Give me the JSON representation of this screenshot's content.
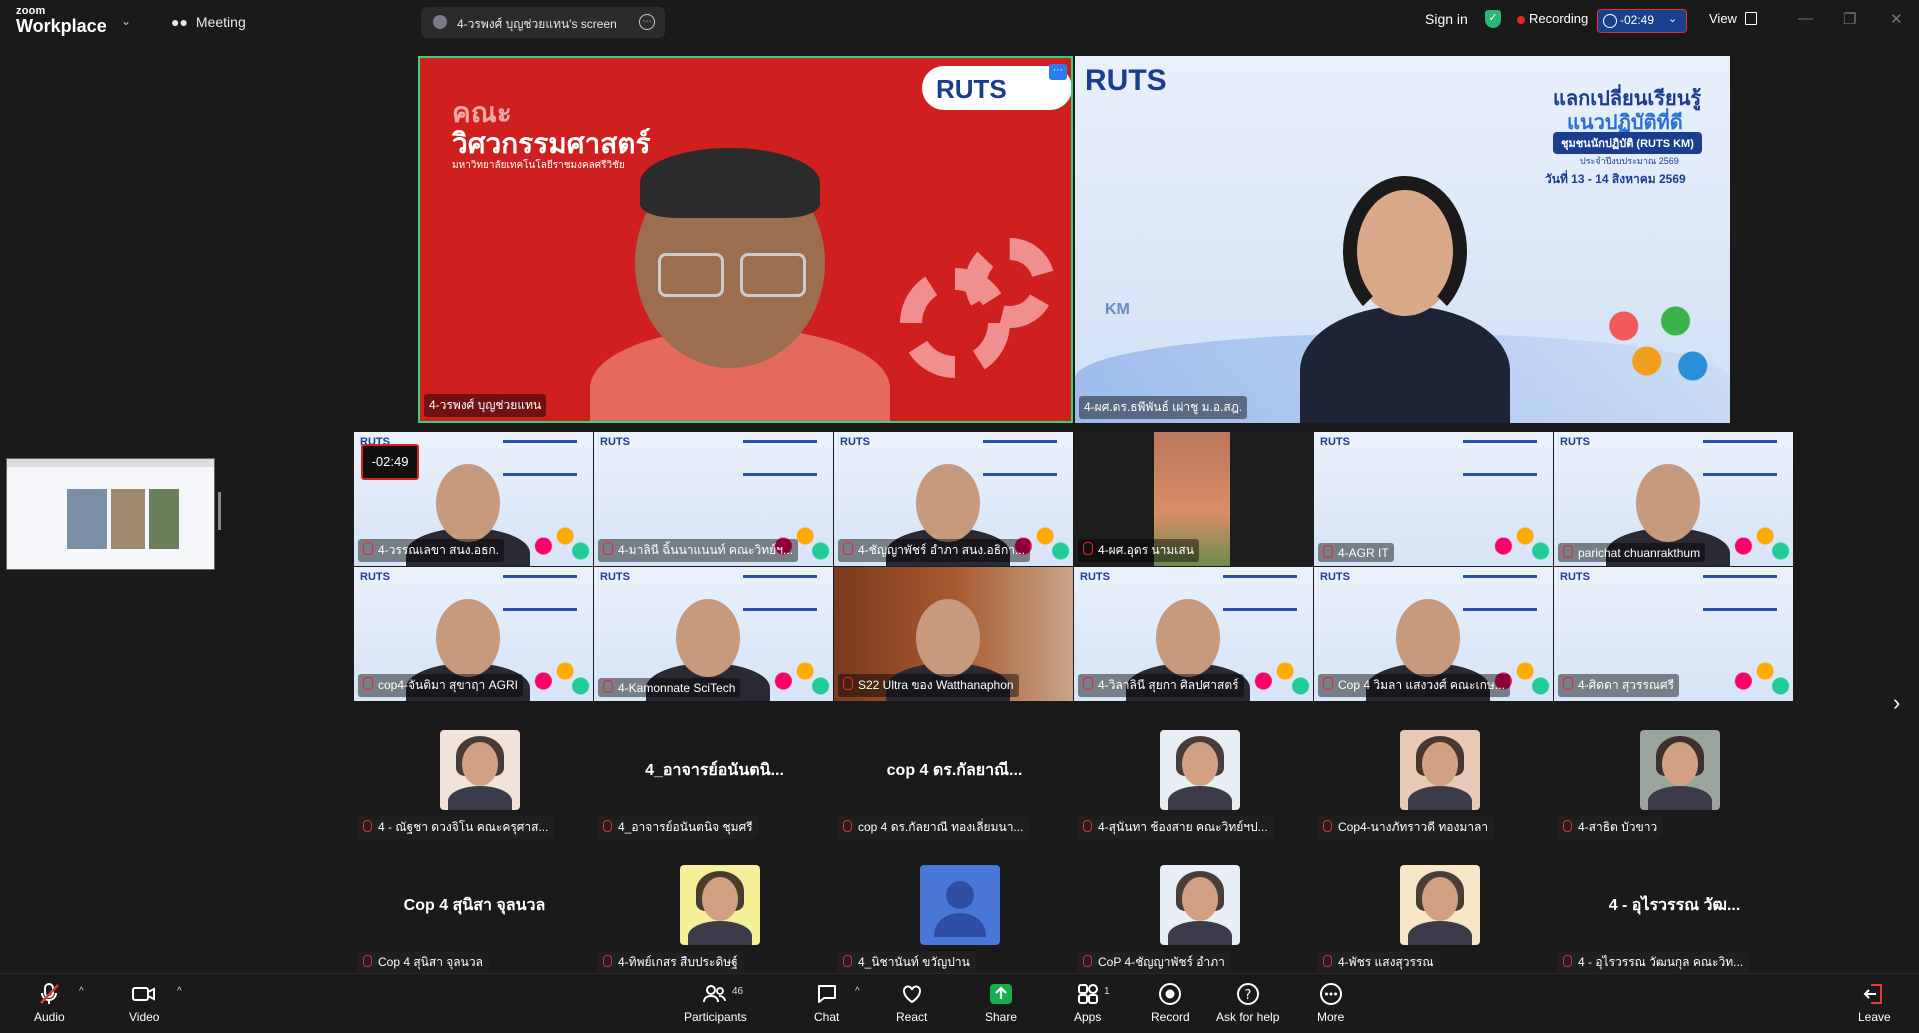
{
  "topbar": {
    "logo_line1": "zoom",
    "logo_line2": "Workplace",
    "meeting_label": "Meeting",
    "tab_title": "4-วรพงศ์ บุญช่วยแทน's screen",
    "signin_label": "Sign in",
    "recording_label": "Recording",
    "timer_value": "-02:49",
    "view_label": "View"
  },
  "main_video": {
    "speaker1_name": "4-วรพงศ์ บุญช่วยแทน",
    "speaker1_bg_title_line1": "คณะ",
    "speaker1_bg_title_line2": "วิศวกรรมศาสตร์",
    "speaker1_bg_subtitle": "มหาวิทยาลัยเทคโนโลยีราชมงคลศรีวิชัย",
    "speaker2_name": "4-ผศ.ดร.ธพีพันธ์ เผ่าชู ม.อ.สฎ.",
    "logo_text": "RUTS",
    "km_title": "แลกเปลี่ยนเรียนรู้",
    "km_subtitle": "แนวปฏิบัติที่ดี",
    "km_sub2": "ชุมชนนักปฏิบัติ (RUTS KM)",
    "km_year": "ประจำปีงบประมาณ 2569",
    "km_date": "วันที่ 13 - 14 สิงหาคม 2569",
    "km_badge": "KM"
  },
  "gallery_timer": "-02:49",
  "gallery": [
    {
      "name": "4-วรรณเลขา  สนง.อธก."
    },
    {
      "name": "4-มาลินี ฉิ้นนาแนนท์ คณะวิทย์ฯ..."
    },
    {
      "name": "4-ชัญญาพัชร์ อำภา สนง.อธิกา..."
    },
    {
      "name": "4-ผศ.อุดร นามเสน"
    },
    {
      "name": "4-AGR IT"
    },
    {
      "name": "parichat chuanrakthum"
    },
    {
      "name": "cop4-จันติมา สุขาฤา AGRI"
    },
    {
      "name": "4-Kamonnate SciTech"
    },
    {
      "name": "S22 Ultra ของ Watthanaphon"
    },
    {
      "name": "4-วิลาลินี สุยกา ศิลปศาสตร์"
    },
    {
      "name": "Cop 4 วิมลา แสงวงศ์ คณะเกษ..."
    },
    {
      "name": "4-ศิดดา สุวรรณศรี"
    }
  ],
  "participants": [
    {
      "big": "",
      "name": "4 - ณัฐชา ดวงจิโน คณะครุศาส..."
    },
    {
      "big": "4_อาจารย์อนันตนิ...",
      "name": "4_อาจารย์อนันตนิจ ชุมศรี"
    },
    {
      "big": "cop 4 ดร.กัลยาณี...",
      "name": "cop 4 ดร.กัลยาณี  ทองเลี่ยมนา..."
    },
    {
      "big": "",
      "name": "4-สุนันทา ช้องสาย คณะวิทย์ฯป..."
    },
    {
      "big": "",
      "name": "Cop4-นางภัทราวดี  ทองมาลา"
    },
    {
      "big": "",
      "name": "4-สาธิต บัวขาว"
    },
    {
      "big": "Cop 4 สุนิสา จุลนวล",
      "name": "Cop 4 สุนิสา จุลนวล"
    },
    {
      "big": "",
      "name": "4-ทิพย์เกสร สืบประดิษฐ์"
    },
    {
      "big": "",
      "name": "4_นิชานันท์ ขวัญปาน"
    },
    {
      "big": "",
      "name": "CoP 4-ชัญญาพัชร์ อำภา"
    },
    {
      "big": "",
      "name": "4-พัชร แสงสุวรรณ"
    },
    {
      "big": "4 - อุไรวรรณ วัฒ...",
      "name": "4 - อุไรวรรณ วัฒนกุล คณะวิท..."
    }
  ],
  "toolbar": {
    "audio": "Audio",
    "video": "Video",
    "participants": "Participants",
    "participants_count": "46",
    "chat": "Chat",
    "react": "React",
    "share": "Share",
    "apps": "Apps",
    "apps_count": "1",
    "record": "Record",
    "ask_help": "Ask for help",
    "more": "More",
    "leave": "Leave"
  },
  "colors": {
    "accent_green": "#38d178",
    "share_green": "#13b04b",
    "record_red": "#e02828",
    "leave_red": "#e23b3b"
  }
}
